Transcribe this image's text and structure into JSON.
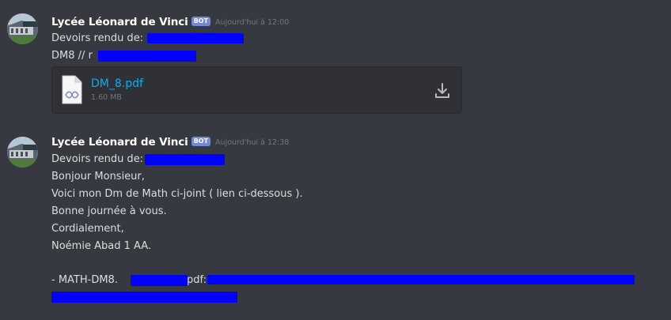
{
  "messages": [
    {
      "username": "Lycée Léonard de Vinci",
      "bot_tag": "BOT",
      "timestamp": "Aujourd'hui à 12:00",
      "lines": [
        "Devoirs rendu de:",
        "DM8 // r"
      ],
      "attachment": {
        "file_name": "DM_8.pdf",
        "file_size": "1.60 MB",
        "file_icon": "document-icon",
        "download_icon": "download-icon"
      }
    },
    {
      "username": "Lycée Léonard de Vinci",
      "bot_tag": "BOT",
      "timestamp": "Aujourd'hui à 12:38",
      "lines": [
        "Devoirs rendu de:",
        "Bonjour Monsieur,",
        "Voici mon Dm de Math ci-joint ( lien ci-dessous ).",
        "Bonne journée à vous.",
        "Cordialement,",
        "Noémie Abad 1 AA.",
        "",
        "- MATH-DM8.",
        "pdf:"
      ]
    }
  ],
  "colors": {
    "background": "#36393f",
    "username": "#ffffff",
    "bot_tag": "#7289da",
    "timestamp": "#72767d",
    "text": "#dcddde",
    "link": "#00b0f4",
    "attachment_bg": "#2f3136",
    "redaction": "#0000ff"
  }
}
